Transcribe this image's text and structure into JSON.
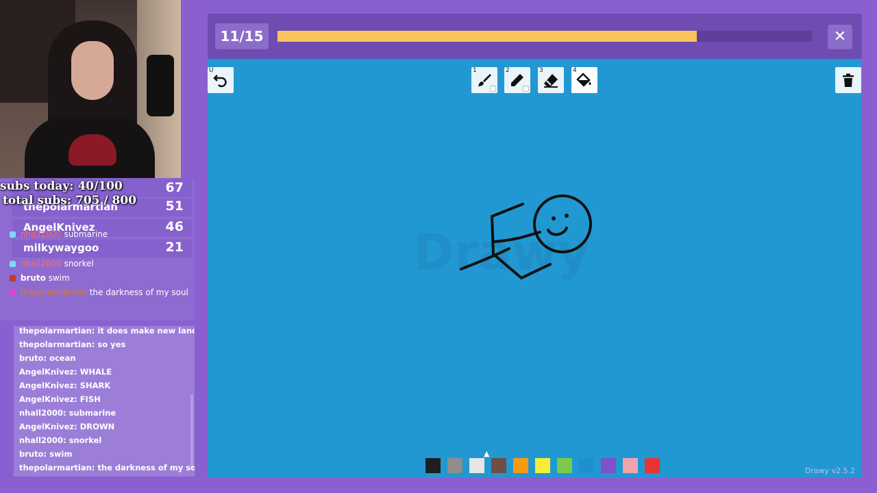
{
  "stream_overlay": {
    "subs_today": "subs today: 40/100",
    "total_subs": "total subs: 705 / 800"
  },
  "leaderboard": [
    {
      "name": "thepolarmartian",
      "score": "51"
    },
    {
      "name": "AngelKnivez",
      "score": "46"
    },
    {
      "name": "milkywaygoo",
      "score": "21"
    }
  ],
  "leaderboard_top_score": "67",
  "live_chat": [
    {
      "user": "nhall2000",
      "message": "submarine",
      "color": "red"
    },
    {
      "user": "AngelKnivez",
      "message": "DROWN",
      "color": "cyan"
    },
    {
      "user": "nhall2000",
      "message": "snorkel",
      "color": "red"
    },
    {
      "user": "bruto",
      "message": "swim",
      "color": "white"
    },
    {
      "user": "thepolarmartian",
      "message": "the darkness of my soul",
      "color": "orange"
    }
  ],
  "chat_log": [
    "thepolarmartian: it does make new land",
    "thepolarmartian: so yes",
    "bruto: ocean",
    "AngelKnivez: WHALE",
    "AngelKnivez: SHARK",
    "AngelKnivez: FISH",
    "nhall2000: submarine",
    "AngelKnivez: DROWN",
    "nhall2000: snorkel",
    "bruto: swim",
    "thepolarmartian: the darkness of my soul"
  ],
  "game": {
    "round": "11/15",
    "progress": 0.785,
    "close_label": "✕",
    "watermark": "Drawy",
    "version": "Drawy v2.5.2",
    "tools": [
      {
        "key": "1",
        "icon": "brush-icon",
        "active": false
      },
      {
        "key": "2",
        "icon": "pencil-icon",
        "active": false
      },
      {
        "key": "3",
        "icon": "eraser-icon",
        "active": false
      },
      {
        "key": "4",
        "icon": "paint-bucket-icon",
        "active": true
      }
    ],
    "undo_key": "U",
    "canvas_color": "#2198d2",
    "palette": [
      "#1e1e1e",
      "#8e8e8e",
      "#e6e6e6",
      "#6e4f45",
      "#f79a12",
      "#f6ec39",
      "#7cca4a",
      "#1f90cf",
      "#7f52c9",
      "#f0a3ad",
      "#e53535"
    ]
  }
}
